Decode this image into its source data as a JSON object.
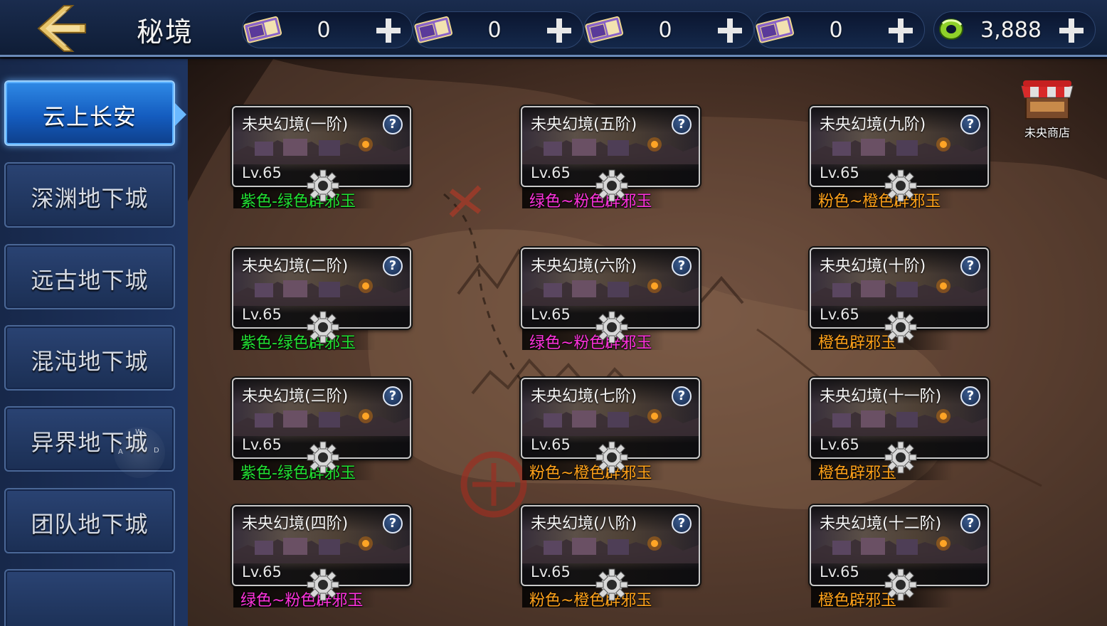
{
  "header": {
    "title": "秘境",
    "back_icon": "back-arrow-icon",
    "resources": [
      {
        "icon": "ticket-icon",
        "value": "0",
        "color": "#8a63c8"
      },
      {
        "icon": "ticket-icon",
        "value": "0",
        "color": "#8a63c8"
      },
      {
        "icon": "ticket-icon",
        "value": "0",
        "color": "#8a63c8"
      },
      {
        "icon": "ticket-icon",
        "value": "0",
        "color": "#8a63c8"
      },
      {
        "icon": "jade-coin-icon",
        "value": "3,888",
        "color": "#8fd12a"
      }
    ],
    "add_icon": "plus-icon"
  },
  "sidebar": {
    "items": [
      {
        "label": "云上长安",
        "active": true
      },
      {
        "label": "深渊地下城",
        "active": false
      },
      {
        "label": "远古地下城",
        "active": false
      },
      {
        "label": "混沌地下城",
        "active": false
      },
      {
        "label": "异界地下城",
        "active": false
      },
      {
        "label": "团队地下城",
        "active": false
      },
      {
        "label": "",
        "active": false
      }
    ]
  },
  "shop": {
    "label": "未央商店",
    "icon": "shop-stall-icon"
  },
  "joystick": {
    "up": "W",
    "left": "A",
    "right": "D"
  },
  "colors": {
    "purple": "#e040ff",
    "green": "#22e033",
    "pink": "#ff33dd",
    "orange": "#ffa21a"
  },
  "dungeons": [
    {
      "name": "未央幻境(一阶)",
      "level": "Lv.65",
      "drop": "紫色-绿色辟邪玉",
      "drop_color": "#22e033"
    },
    {
      "name": "未央幻境(二阶)",
      "level": "Lv.65",
      "drop": "紫色-绿色辟邪玉",
      "drop_color": "#22e033"
    },
    {
      "name": "未央幻境(三阶)",
      "level": "Lv.65",
      "drop": "紫色-绿色辟邪玉",
      "drop_color": "#22e033"
    },
    {
      "name": "未央幻境(四阶)",
      "level": "Lv.65",
      "drop": "绿色~粉色辟邪玉",
      "drop_color": "#ff33dd"
    },
    {
      "name": "未央幻境(五阶)",
      "level": "Lv.65",
      "drop": "绿色~粉色辟邪玉",
      "drop_color": "#ff33dd"
    },
    {
      "name": "未央幻境(六阶)",
      "level": "Lv.65",
      "drop": "绿色~粉色辟邪玉",
      "drop_color": "#ff33dd"
    },
    {
      "name": "未央幻境(七阶)",
      "level": "Lv.65",
      "drop": "粉色~橙色辟邪玉",
      "drop_color": "#ffa21a"
    },
    {
      "name": "未央幻境(八阶)",
      "level": "Lv.65",
      "drop": "粉色~橙色辟邪玉",
      "drop_color": "#ffa21a"
    },
    {
      "name": "未央幻境(九阶)",
      "level": "Lv.65",
      "drop": "粉色~橙色辟邪玉",
      "drop_color": "#ffa21a"
    },
    {
      "name": "未央幻境(十阶)",
      "level": "Lv.65",
      "drop": "橙色辟邪玉",
      "drop_color": "#ffa21a"
    },
    {
      "name": "未央幻境(十一阶)",
      "level": "Lv.65",
      "drop": "橙色辟邪玉",
      "drop_color": "#ffa21a"
    },
    {
      "name": "未央幻境(十二阶)",
      "level": "Lv.65",
      "drop": "橙色辟邪玉",
      "drop_color": "#ffa21a"
    }
  ]
}
